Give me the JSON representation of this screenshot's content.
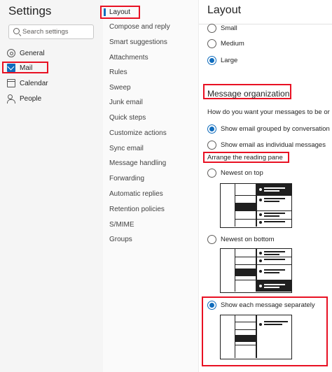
{
  "settings_panel": {
    "title": "Settings",
    "search_placeholder": "Search settings",
    "items": [
      {
        "label": "General",
        "icon": "gear-icon"
      },
      {
        "label": "Mail",
        "icon": "envelope-icon",
        "selected": true
      },
      {
        "label": "Calendar",
        "icon": "calendar-icon"
      },
      {
        "label": "People",
        "icon": "people-icon"
      }
    ]
  },
  "mail_nav": {
    "items": [
      "Layout",
      "Compose and reply",
      "Smart suggestions",
      "Attachments",
      "Rules",
      "Sweep",
      "Junk email",
      "Quick steps",
      "Customize actions",
      "Sync email",
      "Message handling",
      "Forwarding",
      "Automatic replies",
      "Retention policies",
      "S/MIME",
      "Groups"
    ],
    "selected": "Layout"
  },
  "layout_pane": {
    "title": "Layout",
    "text_size_options": [
      {
        "label": "Small",
        "checked": false
      },
      {
        "label": "Medium",
        "checked": false
      },
      {
        "label": "Large",
        "checked": true
      }
    ],
    "message_organization": {
      "title": "Message organization",
      "question": "How do you want your messages to be or",
      "options": [
        {
          "label": "Show email grouped by conversation",
          "checked": true
        },
        {
          "label": "Show email as individual messages",
          "checked": false
        }
      ]
    },
    "reading_pane": {
      "title": "Arrange the reading pane",
      "options": [
        {
          "label": "Newest on top",
          "checked": false
        },
        {
          "label": "Newest on bottom",
          "checked": false
        },
        {
          "label": "Show each message separately",
          "checked": true
        }
      ]
    }
  },
  "colors": {
    "accent": "#0f6cbd",
    "highlight": "#e81123"
  }
}
